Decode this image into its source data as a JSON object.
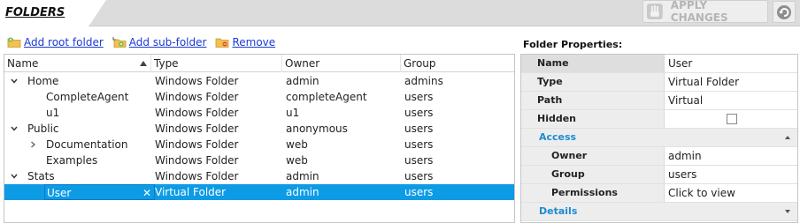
{
  "header": {
    "tab_title": "FOLDERS",
    "apply_label": "APPLY CHANGES"
  },
  "toolbar": {
    "add_root": "Add root folder",
    "add_sub": "Add sub-folder",
    "remove": "Remove"
  },
  "table": {
    "columns": [
      "Name",
      "Type",
      "Owner",
      "Group"
    ],
    "rows": [
      {
        "name": "Home",
        "type": "Windows Folder",
        "owner": "admin",
        "group": "admins"
      },
      {
        "name": "CompleteAgent",
        "type": "Windows Folder",
        "owner": "completeAgent",
        "group": "users"
      },
      {
        "name": "u1",
        "type": "Windows Folder",
        "owner": "u1",
        "group": "users"
      },
      {
        "name": "Public",
        "type": "Windows Folder",
        "owner": "anonymous",
        "group": "users"
      },
      {
        "name": "Documentation",
        "type": "Windows Folder",
        "owner": "web",
        "group": "users"
      },
      {
        "name": "Examples",
        "type": "Windows Folder",
        "owner": "web",
        "group": "users"
      },
      {
        "name": "Stats",
        "type": "Windows Folder",
        "owner": "admin",
        "group": "users"
      },
      {
        "name": "User",
        "type": "Virtual Folder",
        "owner": "admin",
        "group": "users"
      }
    ]
  },
  "properties": {
    "title": "Folder Properties:",
    "name_label": "Name",
    "name_value": "User",
    "type_label": "Type",
    "type_value": "Virtual Folder",
    "path_label": "Path",
    "path_value": "Virtual",
    "hidden_label": "Hidden",
    "access_label": "Access",
    "owner_label": "Owner",
    "owner_value": "admin",
    "group_label": "Group",
    "group_value": "users",
    "permissions_label": "Permissions",
    "permissions_value": "Click to view",
    "details_label": "Details"
  },
  "colors": {
    "selection": "#0d9be6",
    "link": "#1a3ad8",
    "section_label": "#1d8bd1"
  }
}
